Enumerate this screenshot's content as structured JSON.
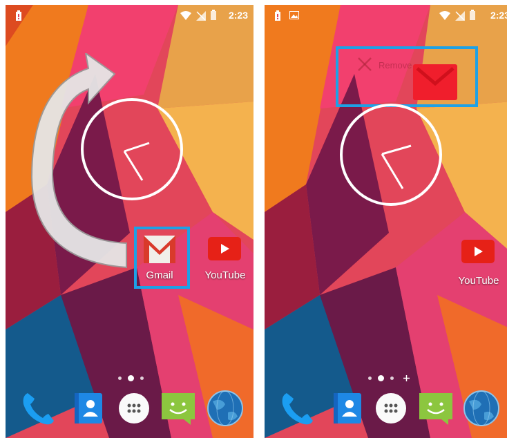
{
  "screens": [
    {
      "status_time": "2:23",
      "apps": {
        "gmail": "Gmail",
        "youtube": "YouTube"
      }
    },
    {
      "status_time": "2:23",
      "remove_label": "Remove",
      "apps": {
        "youtube": "YouTube"
      }
    }
  ],
  "colors": {
    "highlight": "#1da1e6",
    "gmail_red": "#d93a2b",
    "youtube_red": "#e62117",
    "phone_blue": "#1b9ef2",
    "messaging_green": "#8cc63f"
  },
  "icons": {
    "dock": [
      "phone-icon",
      "contacts-icon",
      "app-drawer-icon",
      "messaging-icon",
      "browser-icon"
    ]
  }
}
